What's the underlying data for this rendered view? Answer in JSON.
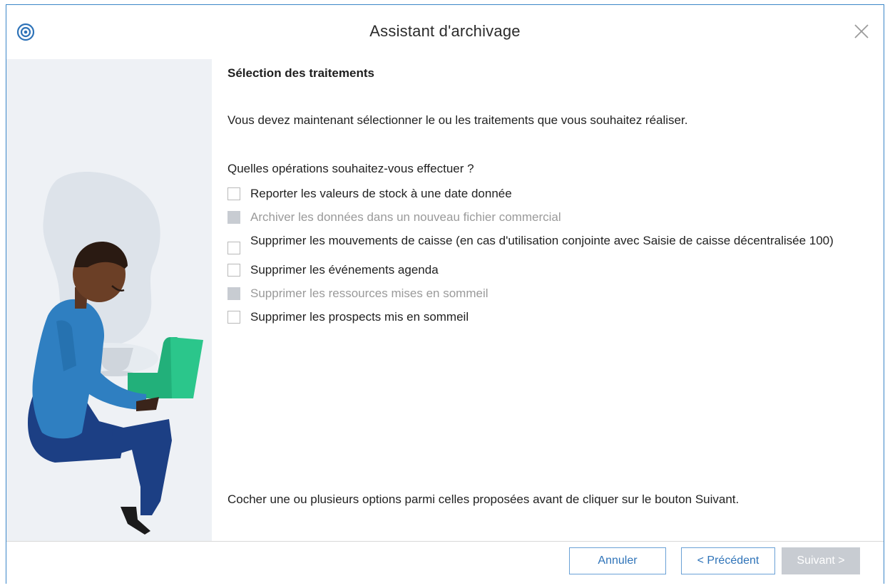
{
  "window": {
    "title": "Assistant d'archivage",
    "app_icon": "app-logo-icon",
    "close_icon": "close-icon"
  },
  "page": {
    "section_title": "Sélection des traitements",
    "intro": "Vous devez maintenant sélectionner le ou les traitements que vous souhaitez réaliser.",
    "question": "Quelles opérations souhaitez-vous effectuer ?",
    "options": [
      {
        "label": "Reporter les valeurs de stock à une date donnée",
        "checked": false,
        "disabled": false
      },
      {
        "label": "Archiver les données dans un nouveau fichier commercial",
        "checked": false,
        "disabled": true
      },
      {
        "label": "Supprimer les mouvements de caisse (en cas d'utilisation conjointe avec Saisie de caisse décentralisée 100)",
        "checked": false,
        "disabled": false
      },
      {
        "label": "Supprimer les événements agenda",
        "checked": false,
        "disabled": false
      },
      {
        "label": "Supprimer les ressources mises en sommeil",
        "checked": false,
        "disabled": true
      },
      {
        "label": "Supprimer les prospects mis en sommeil",
        "checked": false,
        "disabled": false
      }
    ],
    "hint": "Cocher une ou plusieurs options parmi celles proposées avant de cliquer sur le bouton Suivant."
  },
  "footer": {
    "cancel_label": "Annuler",
    "previous_label": "< Précédent",
    "next_label": "Suivant >",
    "next_disabled": true
  },
  "colors": {
    "accent": "#2e73b8",
    "border": "#3b86c8",
    "left_panel": "#eef1f5",
    "disabled": "#c8ccd2",
    "laptop": "#22b07a",
    "shirt": "#2f7fc1",
    "pants": "#1c3f84"
  }
}
